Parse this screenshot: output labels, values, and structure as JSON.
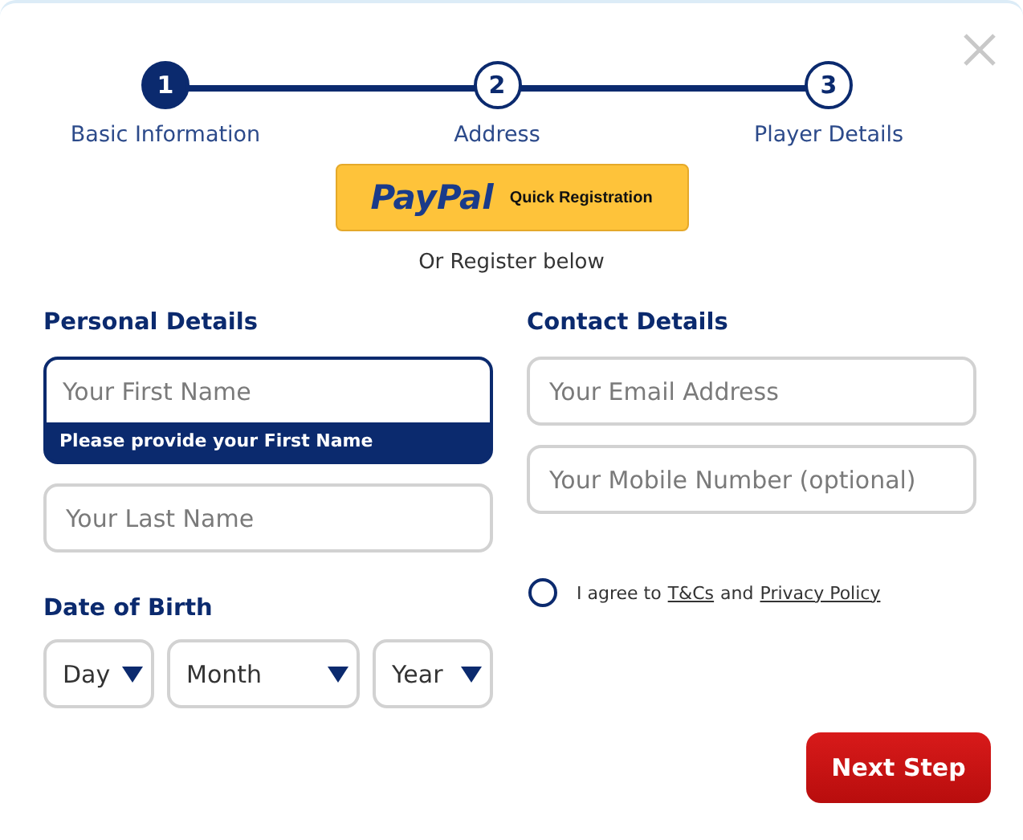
{
  "steps": [
    {
      "number": "1",
      "label": "Basic Information",
      "selected": true
    },
    {
      "number": "2",
      "label": "Address",
      "selected": false
    },
    {
      "number": "3",
      "label": "Player Details",
      "selected": false
    }
  ],
  "paypal": {
    "logo": "PayPal",
    "label": "Quick Registration"
  },
  "alt_text": "Or Register below",
  "personal": {
    "heading": "Personal Details",
    "fields": [
      {
        "placeholder": "Your First Name",
        "error": "Please provide your First Name"
      },
      {
        "placeholder": "Your Last Name"
      }
    ]
  },
  "dob": {
    "heading": "Date of Birth",
    "selects": [
      {
        "value": "Day"
      },
      {
        "value": "Month"
      },
      {
        "value": "Year"
      }
    ]
  },
  "contact": {
    "heading": "Contact Details",
    "fields": [
      {
        "placeholder": "Your Email Address"
      },
      {
        "placeholder": "Your Mobile Number (optional)"
      }
    ]
  },
  "agree": {
    "checked": false,
    "prefix": "I agree to",
    "link_1": "T&Cs",
    "middle": "and",
    "link_2": "Privacy Policy"
  },
  "next_button": "Next Step"
}
